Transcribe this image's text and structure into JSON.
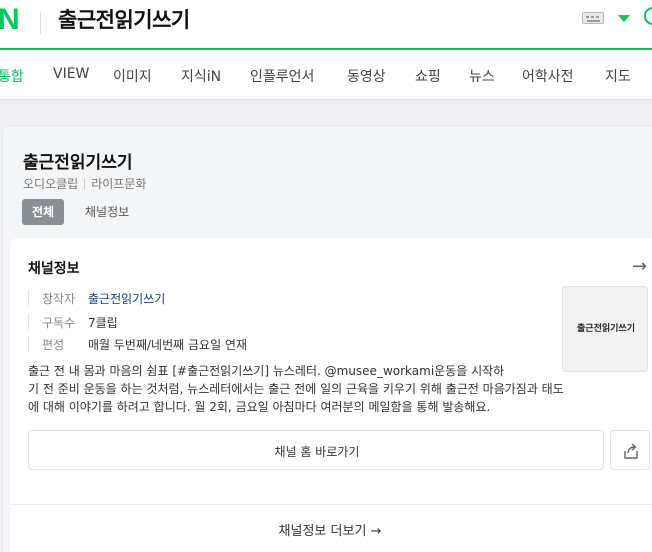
{
  "header": {
    "logo": "N",
    "query": "출근전읽기쓰기"
  },
  "tabs": [
    "통합",
    "VIEW",
    "이미지",
    "지식iN",
    "인플루언서",
    "동영상",
    "쇼핑",
    "뉴스",
    "어학사전",
    "지도"
  ],
  "channel": {
    "title": "출근전읽기쓰기",
    "meta": [
      "오디오클립",
      "라이프문화"
    ],
    "chips": [
      "전체",
      "채널정보"
    ]
  },
  "info": {
    "title": "채널정보",
    "rows": [
      {
        "key": "창작자",
        "value": "출근전읽기쓰기"
      },
      {
        "key": "구독수",
        "value": "7클립"
      },
      {
        "key": "편성",
        "value": "매월 두번째/네번째 금요일 연재"
      }
    ],
    "thumbnail_text": "출근전읽기쓰기",
    "description": [
      "출근 전 내 몸과 마음의 쉼표 [#출근전읽기쓰기] 뉴스레터. @musee_workami운동을 시작하",
      "기 전 준비 운동을 하는 것처럼, 뉴스레터에서는 출근 전에 일의 근육을 키우기 위해 출근전 마음가짐과 태도",
      "에 대해 이야기를 하려고 합니다. 월 2회, 금요일 아침마다 여러분의 메일함을 통해 발송해요."
    ],
    "home_button": "채널 홈 바로가기",
    "more_link": "채널정보 더보기 →"
  },
  "colors": {
    "brand": "#03c75a",
    "link": "#1d3f7a"
  }
}
